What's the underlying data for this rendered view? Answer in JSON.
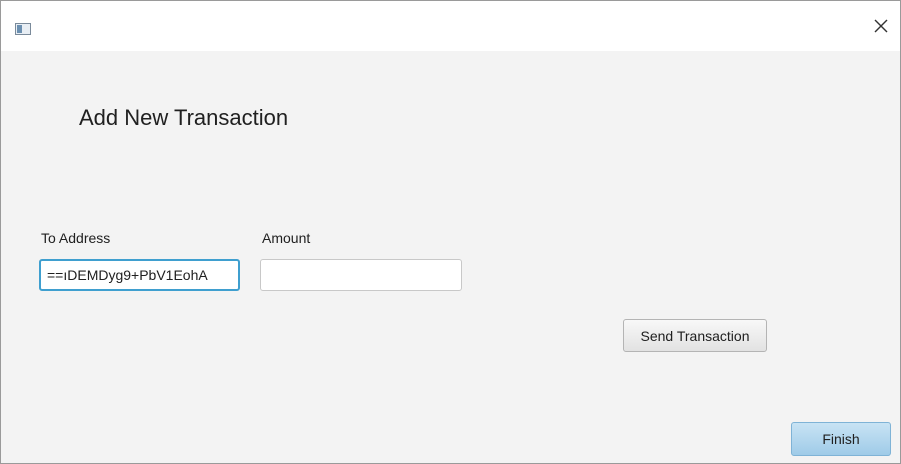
{
  "window": {
    "title": "",
    "icon": "app-window-icon",
    "close_icon": "close-icon"
  },
  "page": {
    "heading": "Add New Transaction"
  },
  "form": {
    "to_address_label": "To Address",
    "to_address_value": "ıDEMDyg9+PbV1EohA==",
    "amount_label": "Amount",
    "amount_value": ""
  },
  "buttons": {
    "send_label": "Send Transaction",
    "finish_label": "Finish"
  },
  "colors": {
    "focus_border": "#3f9fcf",
    "finish_button": "#a9d2ec",
    "window_bg": "#f3f3f3"
  }
}
